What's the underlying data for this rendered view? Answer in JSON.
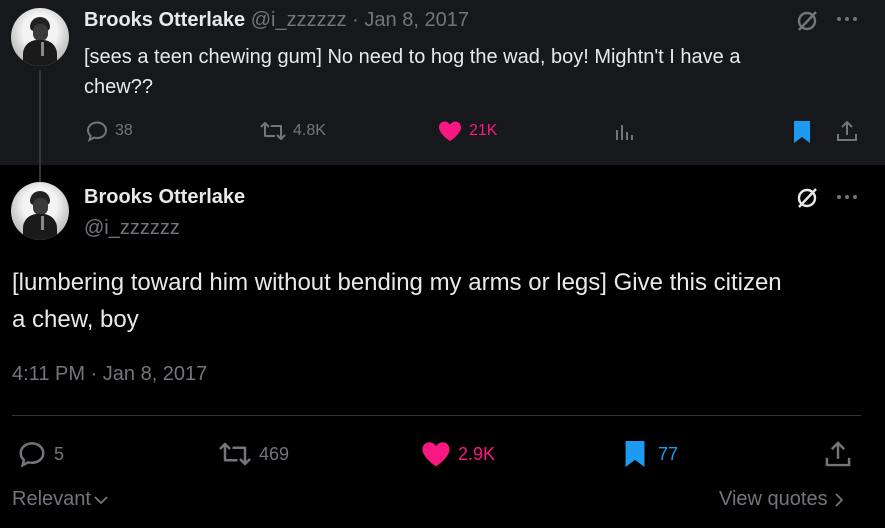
{
  "parent_tweet": {
    "display_name": "Brooks Otterlake",
    "handle": "@i_zzzzzz",
    "date": "Jan 8, 2017",
    "separator": "·",
    "text_line1": "[sees a teen chewing gum] No need to hog the wad, boy! Mightn't I have a",
    "text_line2": "chew??",
    "replies": "38",
    "reposts": "4.8K",
    "likes": "21K"
  },
  "main_tweet": {
    "display_name": "Brooks Otterlake",
    "handle": "@i_zzzzzz",
    "text_line1": "[lumbering toward him without bending my arms or legs] Give this citizen",
    "text_line2": "a chew, boy",
    "timestamp": "4:11 PM · Jan 8, 2017",
    "replies": "5",
    "reposts": "469",
    "likes": "2.9K",
    "bookmarks": "77"
  },
  "footer": {
    "sort_label": "Relevant",
    "view_quotes_label": "View quotes"
  },
  "colors": {
    "like": "#f91880",
    "bookmark": "#1d9bf0",
    "muted": "#71767b",
    "text": "#e7e9ea"
  }
}
